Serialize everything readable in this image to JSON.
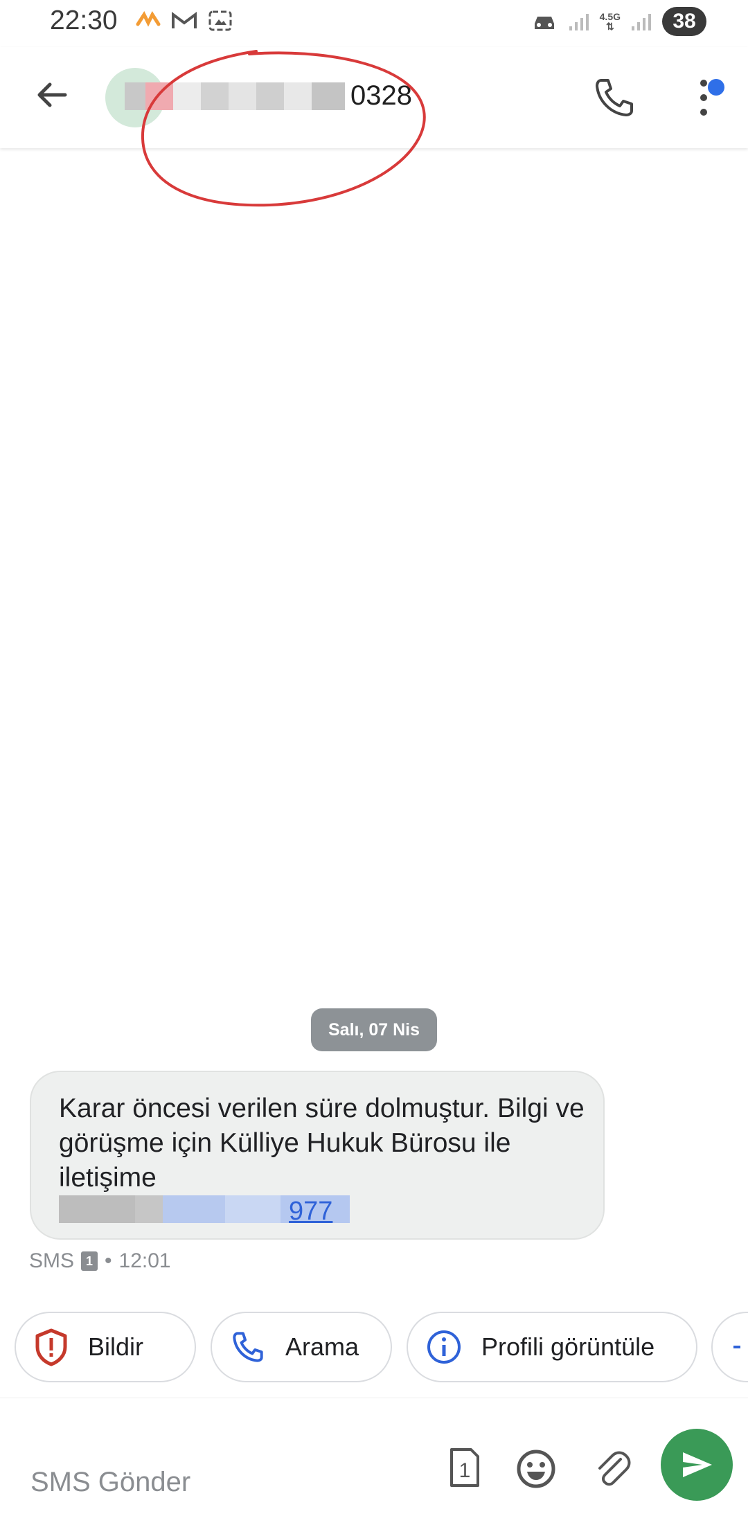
{
  "status_bar": {
    "time": "22:30",
    "network": "4.5G",
    "battery": "38"
  },
  "header": {
    "contact_suffix": "0328"
  },
  "conversation": {
    "date_label": "Salı, 07 Nis",
    "message": {
      "text": "Karar öncesi verilen süre dolmuştur. Bilgi ve görüşme için Külliye Hukuk Bürosu ile iletişime",
      "link_tail": "977",
      "service": "SMS",
      "sim": "1",
      "separator": "•",
      "time": "12:01"
    }
  },
  "suggestions": {
    "report": "Bildir",
    "call": "Arama",
    "view_profile": "Profili görüntüle"
  },
  "compose": {
    "placeholder": "SMS Gönder",
    "sim_slot": "1"
  },
  "colors": {
    "accent_green": "#3a9a57",
    "link_blue": "#2f62d8",
    "notification_dot": "#2f6fe8",
    "annotation_red": "#d83a3a"
  },
  "icons": [
    "back-arrow-icon",
    "phone-icon",
    "more-vert-icon",
    "shield-alert-icon",
    "info-icon",
    "sim-card-icon",
    "emoji-icon",
    "paperclip-icon",
    "send-icon"
  ]
}
